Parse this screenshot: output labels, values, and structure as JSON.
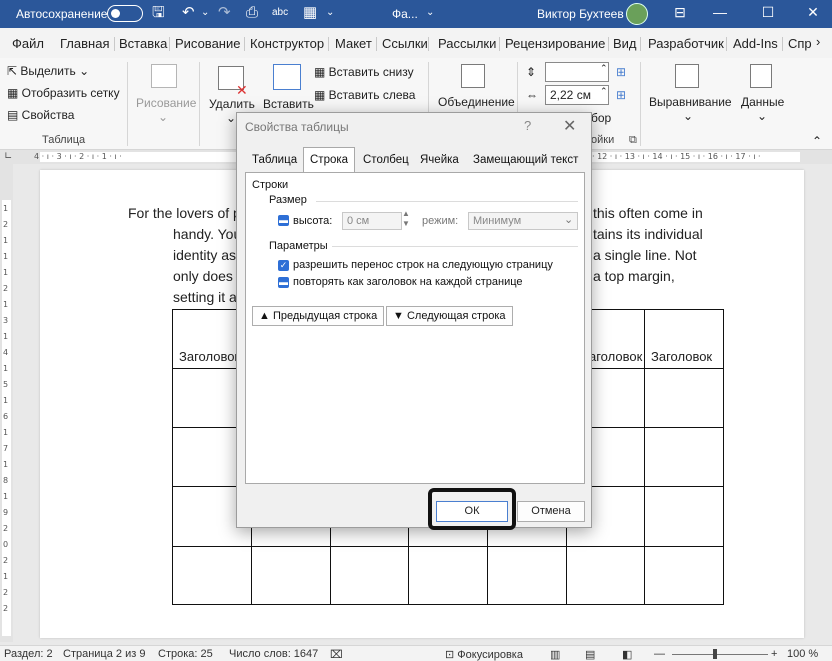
{
  "titlebar": {
    "autosave_label": "Автосохранение",
    "doc_title": "Фа...",
    "user_name": "Виктор Бухтеев"
  },
  "menu_tabs": [
    "Файл",
    "Главная",
    "Вставка",
    "Рисование",
    "Конструктор",
    "Макет",
    "Ссылки",
    "Рассылки",
    "Рецензирование",
    "Вид",
    "Разработчик",
    "Add-Ins",
    "Спр"
  ],
  "ribbon": {
    "select": "Выделить",
    "gridlines": "Отобразить сетку",
    "properties": "Свойства",
    "table_group": "Таблица",
    "drawing": "Рисование",
    "delete": "Удалить",
    "insert_above": "Вставить",
    "insert_below": "Вставить снизу",
    "insert_left": "Вставить слева",
    "merge": "Объединение",
    "height_value": "",
    "width_value": "2,22 см",
    "cell_group_tail": "ойки",
    "align_tail": "бор",
    "alignment": "Выравнивание",
    "data": "Данные"
  },
  "ruler": {
    "left_marks": "4 · ı · 3 · ı · 2 · ı · 1 · ı ·",
    "right_marks": "· 12 · ı · 13 · ı · 14 · ı · 15 · ı · 16 · ı · 17 · ı ·",
    "v_marks": [
      "1",
      "2",
      "1",
      "1",
      "1",
      "2",
      "1",
      "3",
      "1",
      "4",
      "1",
      "5",
      "1",
      "6",
      "1",
      "7",
      "1",
      "8",
      "1",
      "9",
      "2",
      "0",
      "2",
      "1",
      "2",
      "2"
    ]
  },
  "document": {
    "lines": [
      {
        "left": "For the lovers of p",
        "right": "this often come in"
      },
      {
        "left": "handy. You",
        "right": "tains its individual"
      },
      {
        "left": "identity as",
        "right": "a single line. Not"
      },
      {
        "left": "only does t",
        "right": "a top margin,"
      },
      {
        "left": "setting it a",
        "right": ""
      }
    ],
    "header_cells": [
      "Заголовок",
      "аголовок",
      "Заголовок"
    ]
  },
  "dialog": {
    "title": "Свойства таблицы",
    "help": "?",
    "close": "✕",
    "tabs": [
      "Таблица",
      "Строка",
      "Столбец",
      "Ячейка",
      "Замещающий текст"
    ],
    "active_tab": "Строка",
    "section_rows": "Строки",
    "size_label": "Размер",
    "height_label": "высота:",
    "height_value": "0 см",
    "mode_label": "режим:",
    "mode_value": "Минимум",
    "params_label": "Параметры",
    "allow_break": "разрешить перенос строк на следующую страницу",
    "repeat_header": "повторять как заголовок на каждой странице",
    "prev_row": "Предыдущая строка",
    "next_row": "Следующая строка",
    "ok": "ОК",
    "cancel": "Отмена"
  },
  "statusbar": {
    "section": "Раздел: 2",
    "page": "Страница 2 из 9",
    "line": "Строка: 25",
    "words": "Число слов: 1647",
    "focus": "Фокусировка",
    "zoom": "100 %"
  },
  "colors": {
    "titlebar": "#2b579a",
    "checkbox": "#2e6fd6"
  }
}
